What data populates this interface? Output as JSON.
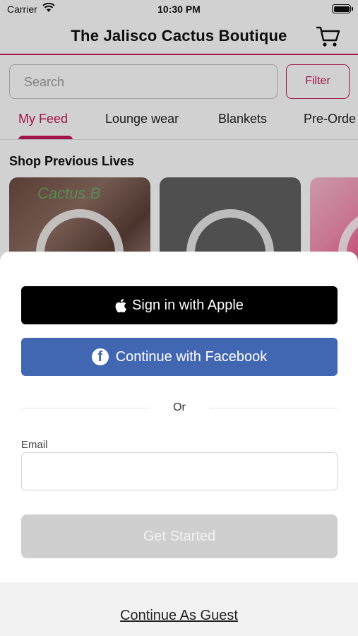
{
  "status_bar": {
    "carrier": "Carrier",
    "time": "10:30 PM"
  },
  "nav": {
    "title": "The Jalisco Cactus Boutique"
  },
  "search": {
    "placeholder": "Search",
    "filter_label": "Filter"
  },
  "tabs": [
    {
      "label": "My Feed",
      "active": true
    },
    {
      "label": "Lounge wear",
      "active": false
    },
    {
      "label": "Blankets",
      "active": false
    },
    {
      "label": "Pre-Orde",
      "active": false
    }
  ],
  "section": {
    "title": "Shop Previous Lives"
  },
  "thumbnails": [
    {
      "overlay_text": "Cactus B"
    },
    {
      "overlay_text": ""
    },
    {
      "overlay_text": ""
    }
  ],
  "sheet": {
    "apple_label": "Sign in with Apple",
    "facebook_label": "Continue with Facebook",
    "or_label": "Or",
    "email_label": "Email",
    "email_value": "",
    "start_label": "Get Started",
    "guest_label": "Continue As Guest"
  },
  "colors": {
    "accent": "#c2185b",
    "facebook": "#4267b2",
    "apple": "#000000",
    "disabled": "#cfcfcf"
  }
}
